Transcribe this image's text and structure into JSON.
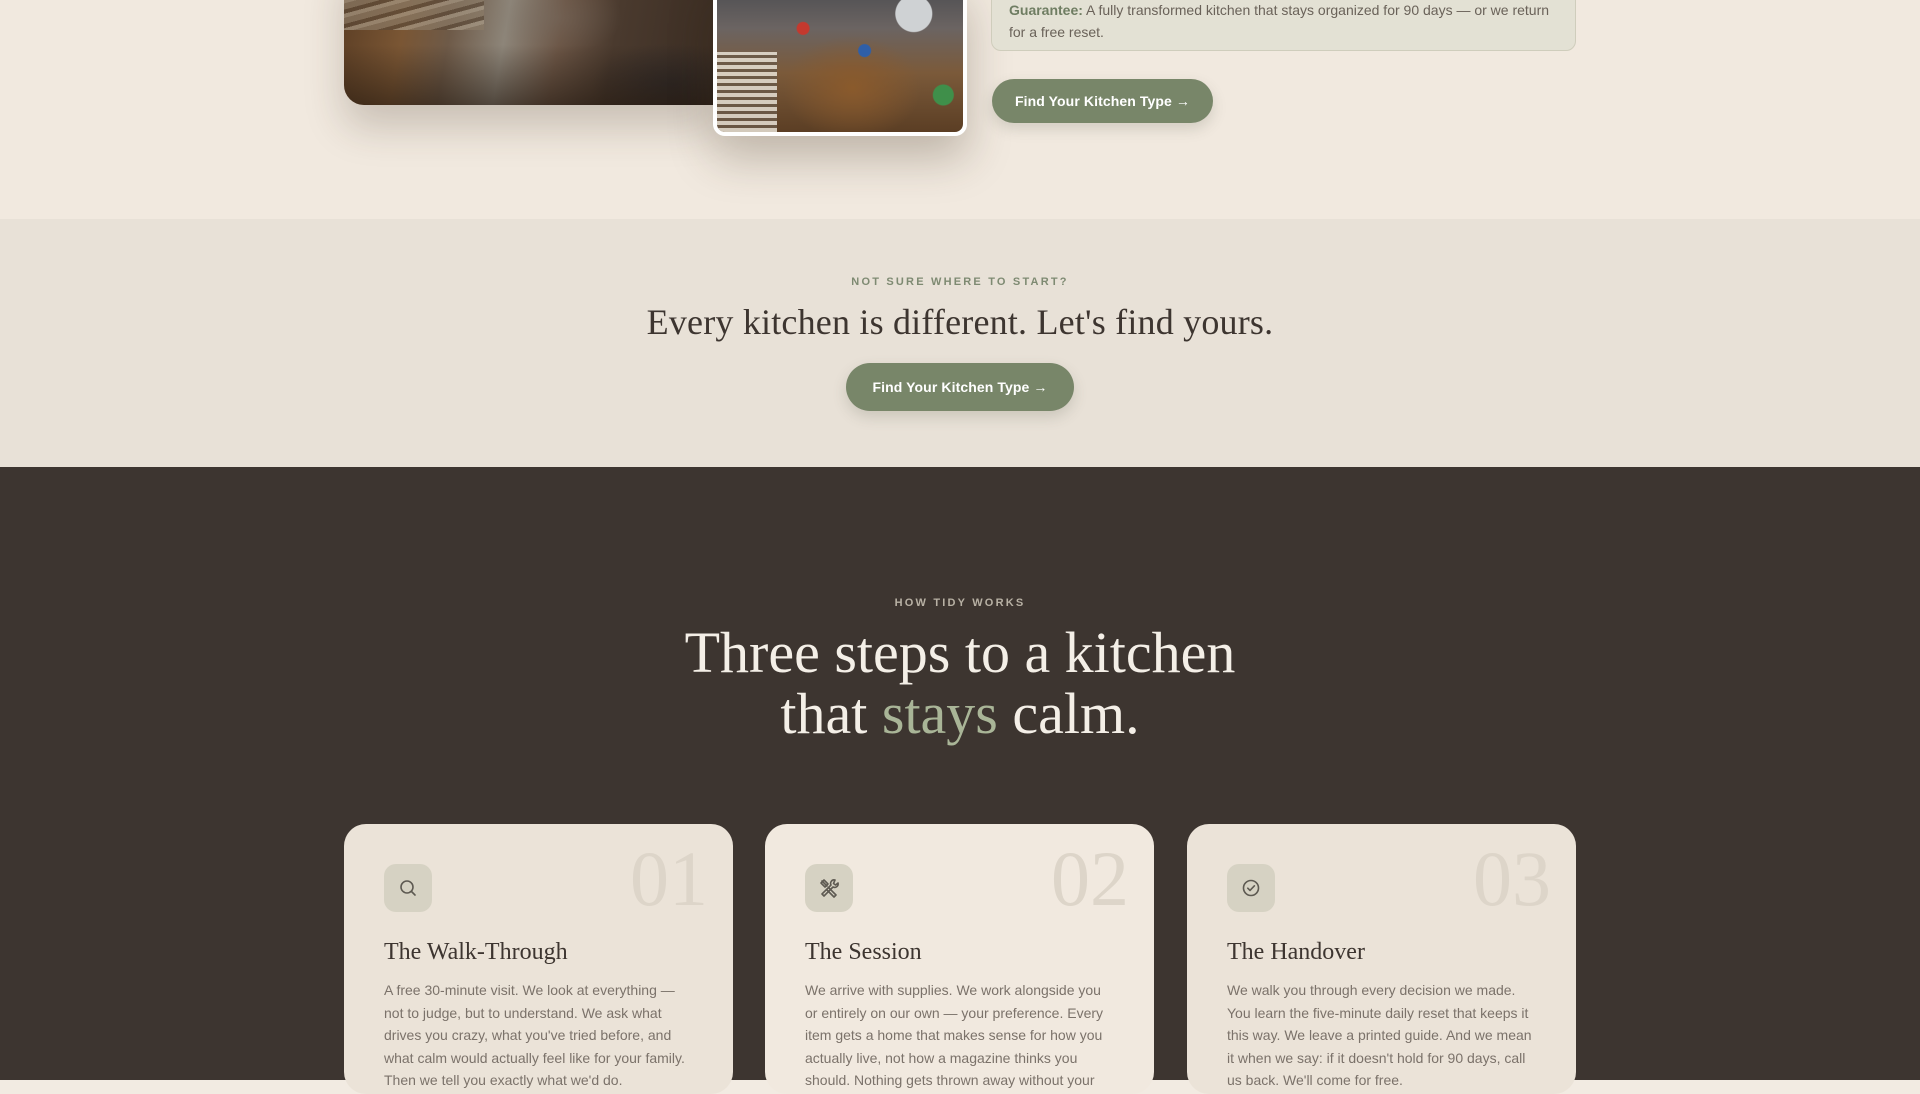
{
  "hero": {
    "guarantee_label": "Guarantee:",
    "guarantee_text": "A fully transformed kitchen that stays organized for 90 days — or we return for a free reset.",
    "cta_label": "Find Your Kitchen Type →"
  },
  "cta_band": {
    "eyebrow": "NOT SURE WHERE TO START?",
    "heading": "Every kitchen is different. Let's find yours.",
    "button_label": "Find Your Kitchen Type →"
  },
  "how_it_works": {
    "eyebrow": "HOW TIDY WORKS",
    "heading_line1": "Three steps to a kitchen",
    "heading_line2_before": "that",
    "heading_line2_accent": "stays",
    "heading_line2_after": "calm.",
    "steps": [
      {
        "number": "01",
        "icon": "search-icon",
        "title": "The Walk-Through",
        "text": "A free 30-minute visit. We look at everything — not to judge, but to understand. We ask what drives you crazy, what you've tried before, and what calm would actually feel like for your family. Then we tell you exactly what we'd do."
      },
      {
        "number": "02",
        "icon": "tools-icon",
        "title": "The Session",
        "text": "We arrive with supplies. We work alongside you or entirely on our own — your preference. Every item gets a home that makes sense for how you actually live, not how a magazine thinks you should. Nothing gets thrown away without your say."
      },
      {
        "number": "03",
        "icon": "check-circle-icon",
        "title": "The Handover",
        "text": "We walk you through every decision we made. You learn the five-minute daily reset that keeps it this way. We leave a printed guide. And we mean it when we say: if it doesn't hold for 90 days, call us back. We'll come for free."
      }
    ]
  }
}
